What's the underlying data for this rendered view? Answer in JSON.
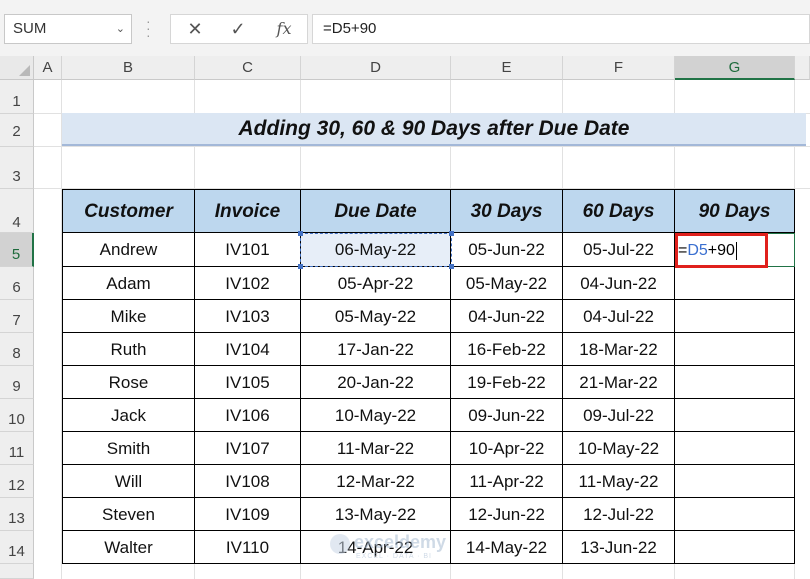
{
  "formula_bar": {
    "name_box": "SUM",
    "cancel_icon": "✕",
    "enter_icon": "✓",
    "fx_label": "fx",
    "formula": "=D5+90"
  },
  "columns": [
    "A",
    "B",
    "C",
    "D",
    "E",
    "F",
    "G"
  ],
  "selected_column": "G",
  "rows": [
    "1",
    "2",
    "3",
    "4",
    "5",
    "6",
    "7",
    "8",
    "9",
    "10",
    "11",
    "12",
    "13",
    "14"
  ],
  "selected_row": "5",
  "title": "Adding 30, 60 & 90 Days after Due Date",
  "table": {
    "headers": [
      "Customer",
      "Invoice",
      "Due Date",
      "30 Days",
      "60 Days",
      "90 Days"
    ],
    "rows": [
      [
        "Andrew",
        "IV101",
        "06-May-22",
        "05-Jun-22",
        "05-Jul-22",
        ""
      ],
      [
        "Adam",
        "IV102",
        "05-Apr-22",
        "05-May-22",
        "04-Jun-22",
        ""
      ],
      [
        "Mike",
        "IV103",
        "05-May-22",
        "04-Jun-22",
        "04-Jul-22",
        ""
      ],
      [
        "Ruth",
        "IV104",
        "17-Jan-22",
        "16-Feb-22",
        "18-Mar-22",
        ""
      ],
      [
        "Rose",
        "IV105",
        "20-Jan-22",
        "19-Feb-22",
        "21-Mar-22",
        ""
      ],
      [
        "Jack",
        "IV106",
        "10-May-22",
        "09-Jun-22",
        "09-Jul-22",
        ""
      ],
      [
        "Smith",
        "IV107",
        "11-Mar-22",
        "10-Apr-22",
        "10-May-22",
        ""
      ],
      [
        "Will",
        "IV108",
        "12-Mar-22",
        "11-Apr-22",
        "11-May-22",
        ""
      ],
      [
        "Steven",
        "IV109",
        "13-May-22",
        "12-Jun-22",
        "12-Jul-22",
        ""
      ],
      [
        "Walter",
        "IV110",
        "14-Apr-22",
        "14-May-22",
        "13-Jun-22",
        ""
      ]
    ]
  },
  "editing_cell": {
    "prefix": "=",
    "ref": "D5",
    "suffix": "+90"
  },
  "watermark": {
    "name": "exceldemy",
    "tagline": "EXCEL · DATA · BI"
  },
  "colors": {
    "header_fill": "#bdd7ee",
    "title_fill": "#dbe6f3",
    "edit_border": "#e0201c",
    "excel_green": "#217346"
  }
}
